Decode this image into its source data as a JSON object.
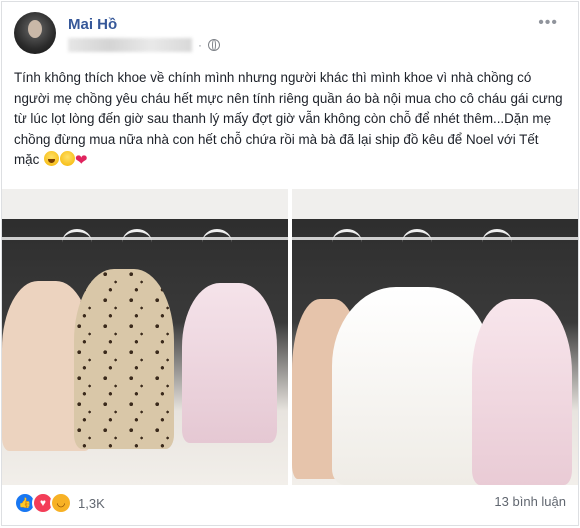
{
  "post": {
    "author": "Mai Hồ",
    "text": "Tính không thích khoe về chính mình nhưng người khác thì mình khoe vì nhà chồng có người mẹ chồng yêu cháu hết mực nên tính riêng quần áo bà nội mua cho cô cháu gái cưng từ lúc lọt lòng đến giờ sau thanh lý mấy đợt giờ vẫn không còn chỗ để nhét thêm...Dặn mẹ chồng đừng mua nữa nhà con hết chỗ chứa rồi mà bà đã lại ship đồ kêu để Noel với Tết mặc",
    "reactions_count": "1,3K",
    "comments_label": "13 bình luận"
  },
  "icons": {
    "privacy": "globe-icon",
    "more": "more-options-icon",
    "reactions": [
      "like-icon",
      "love-icon",
      "haha-icon"
    ]
  },
  "colors": {
    "author_link": "#365899",
    "like": "#1877f2",
    "love": "#f33e58",
    "haha": "#f7b125"
  }
}
